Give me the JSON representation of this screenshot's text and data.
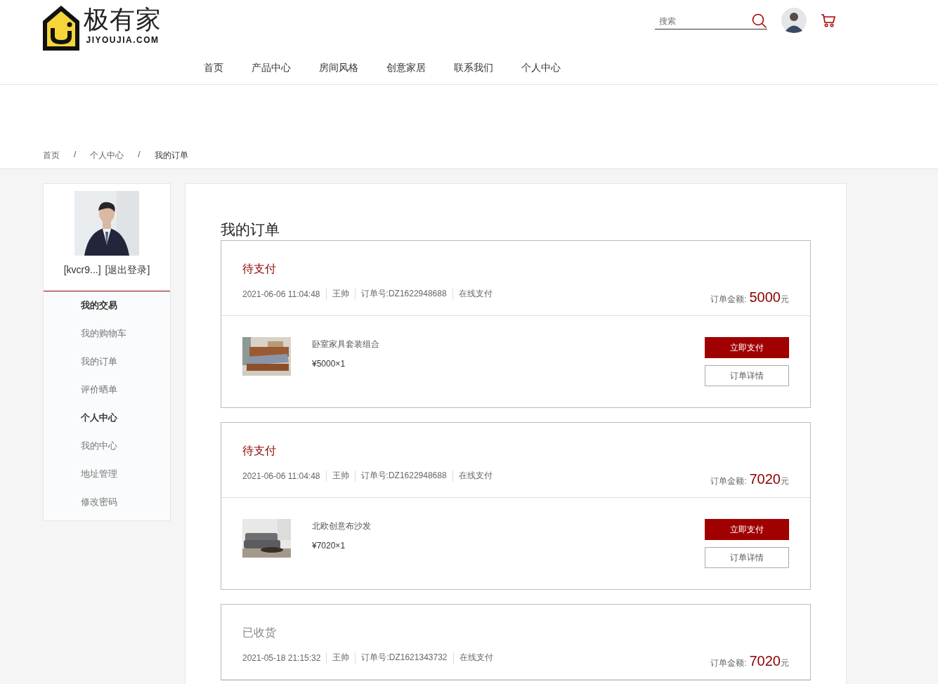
{
  "logo": {
    "name": "极有家",
    "domain": "JIYOUJIA.COM"
  },
  "search": {
    "placeholder": "搜索"
  },
  "nav": [
    {
      "label": "首页",
      "selected": false
    },
    {
      "label": "产品中心",
      "selected": false
    },
    {
      "label": "房间风格",
      "selected": false
    },
    {
      "label": "创意家居",
      "selected": false
    },
    {
      "label": "联系我们",
      "selected": false
    },
    {
      "label": "个人中心",
      "selected": false
    }
  ],
  "breadcrumb": [
    {
      "label": "首页",
      "kind": "link"
    },
    {
      "label": "/",
      "kind": "separator"
    },
    {
      "label": "个人中心",
      "kind": "link"
    },
    {
      "label": "/",
      "kind": "separator"
    },
    {
      "label": "我的订单",
      "kind": "current"
    }
  ],
  "profile": {
    "username": "[kvcr9...]",
    "logout": "[退出登录]"
  },
  "sidebar": [
    {
      "label": "我的交易",
      "kind": "header"
    },
    {
      "label": "我的购物车",
      "kind": "link"
    },
    {
      "label": "我的订单",
      "kind": "link"
    },
    {
      "label": "评价晒单",
      "kind": "link"
    },
    {
      "label": "个人中心",
      "kind": "header"
    },
    {
      "label": "我的中心",
      "kind": "link"
    },
    {
      "label": "地址管理",
      "kind": "link"
    },
    {
      "label": "修改密码",
      "kind": "link"
    }
  ],
  "page_title": "我的订单",
  "orders": [
    {
      "status": "待支付",
      "pending": true,
      "time": "2021-06-06 11:04:48",
      "buyer": "王帅",
      "order_no": "订单号:DZ1622948688",
      "payment": "在线支付",
      "amount_label": "订单金额:",
      "amount": "5000",
      "unit": "元",
      "item": {
        "name": "卧室家具套装组合",
        "price": "¥5000×1"
      },
      "buttons": [
        "立即支付",
        "订单详情"
      ]
    },
    {
      "status": "待支付",
      "pending": true,
      "time": "2021-06-06 11:04:48",
      "buyer": "王帅",
      "order_no": "订单号:DZ1622948688",
      "payment": "在线支付",
      "amount_label": "订单金额:",
      "amount": "7020",
      "unit": "元",
      "item": {
        "name": "北欧创意布沙发",
        "price": "¥7020×1"
      },
      "buttons": [
        "立即支付",
        "订单详情"
      ]
    },
    {
      "status": "已收货",
      "pending": false,
      "time": "2021-05-18 21:15:32",
      "buyer": "王帅",
      "order_no": "订单号:DZ1621343732",
      "payment": "在线支付",
      "amount_label": "订单金额:",
      "amount": "7020",
      "unit": "元"
    }
  ]
}
